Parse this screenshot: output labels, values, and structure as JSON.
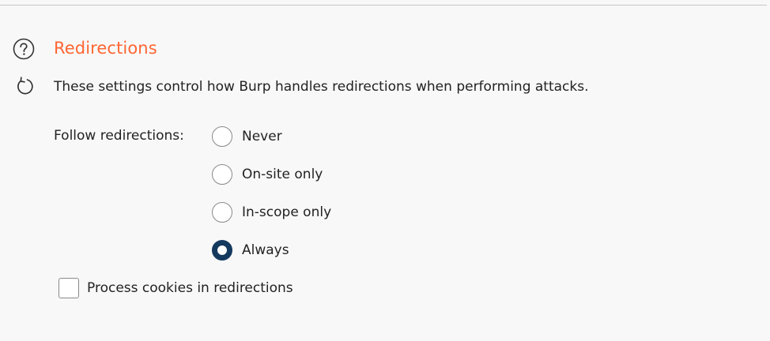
{
  "section": {
    "title": "Redirections",
    "description": "These settings control how Burp handles redirections when performing attacks.",
    "help_icon": "question-circle-icon",
    "reset_icon": "refresh-icon"
  },
  "follow_redirections": {
    "label": "Follow redirections:",
    "options": [
      {
        "label": "Never",
        "selected": false
      },
      {
        "label": "On-site only",
        "selected": false
      },
      {
        "label": "In-scope only",
        "selected": false
      },
      {
        "label": "Always",
        "selected": true
      }
    ]
  },
  "process_cookies": {
    "label": "Process cookies in redirections",
    "checked": false
  },
  "colors": {
    "title": "#ff6633",
    "selected_radio": "#14395e",
    "background": "#f8f8f8"
  }
}
